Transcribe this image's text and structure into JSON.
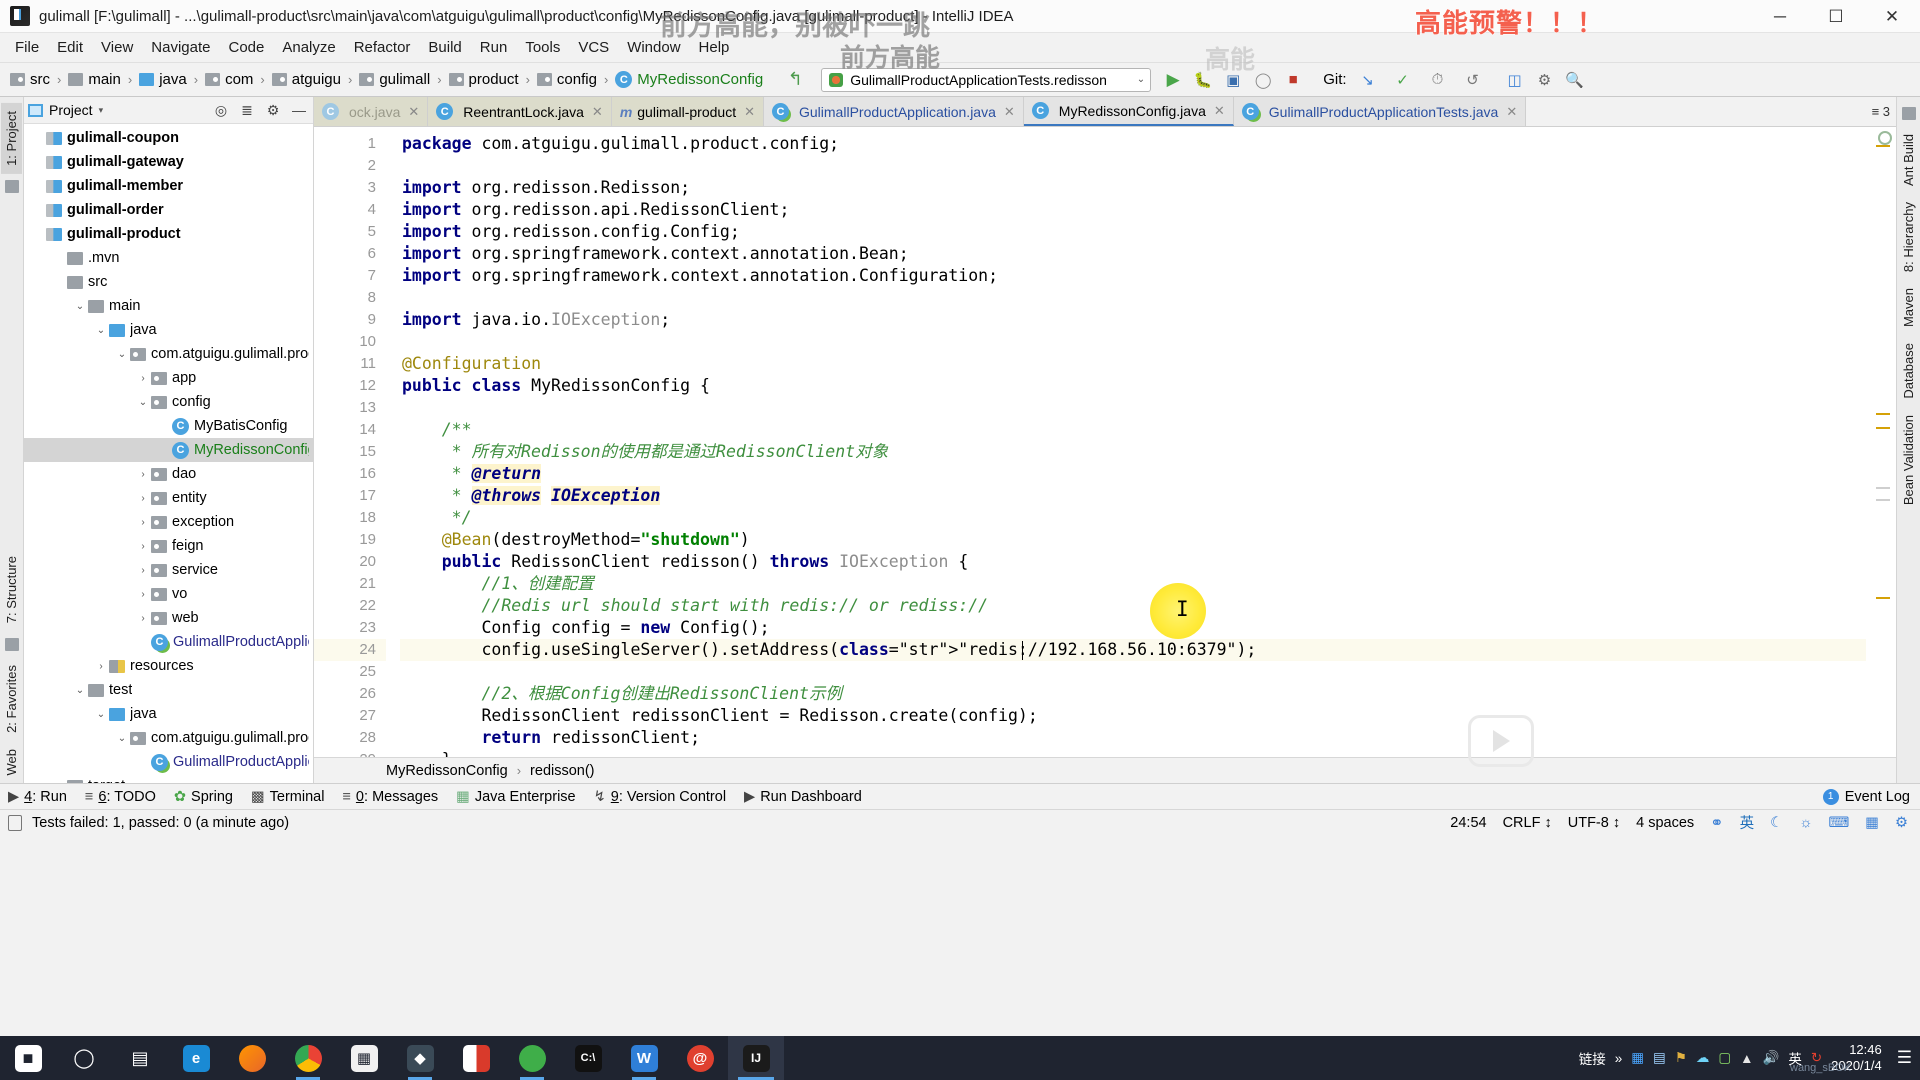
{
  "window": {
    "title": "gulimall [F:\\gulimall] - ...\\gulimall-product\\src\\main\\java\\com\\atguigu\\gulimall\\product\\config\\MyRedissonConfig.java [gulimall-product] - IntelliJ IDEA",
    "minimize": "─",
    "maximize": "☐",
    "close": "✕"
  },
  "menu": {
    "items": [
      "File",
      "Edit",
      "View",
      "Navigate",
      "Code",
      "Analyze",
      "Refactor",
      "Build",
      "Run",
      "Tools",
      "VCS",
      "Window",
      "Help"
    ]
  },
  "breadcrumb": {
    "items": [
      {
        "label": "src",
        "icon": "folder-source-icon"
      },
      {
        "label": "main",
        "icon": "folder-icon"
      },
      {
        "label": "java",
        "icon": "folder-java-icon"
      },
      {
        "label": "com",
        "icon": "package-icon"
      },
      {
        "label": "atguigu",
        "icon": "package-icon"
      },
      {
        "label": "gulimall",
        "icon": "package-icon"
      },
      {
        "label": "product",
        "icon": "package-icon"
      },
      {
        "label": "config",
        "icon": "package-icon"
      },
      {
        "label": "MyRedissonConfig",
        "icon": "java-class-icon"
      }
    ],
    "separator": "›"
  },
  "run_config": {
    "name": "GulimallProductApplicationTests.redisson",
    "dropdown_arrow": "⌄",
    "run_icon": "run-icon",
    "debug_icon": "debug-icon",
    "coverage_icon": "run-with-coverage-icon",
    "profile_icon": "profile-icon",
    "stop_icon": "stop-icon"
  },
  "git": {
    "label": "Git:",
    "update_icon": "update-project-icon",
    "commit_icon": "commit-icon",
    "history_icon": "history-icon",
    "rollback_icon": "rollback-icon"
  },
  "toolbar_right": {
    "search_icon": "search-everywhere-icon",
    "settings_icon": "settings-icon",
    "layout_icon": "layout-icon"
  },
  "project_panel": {
    "title": "Project",
    "caret": "▾",
    "locate_icon": "scroll-from-source-icon",
    "collapse_icon": "collapse-all-icon",
    "settings_icon": "gear-icon",
    "hide_icon": "hide-icon",
    "tree": [
      {
        "label": "gulimall-coupon",
        "indent": 0,
        "arrow": "",
        "icon": "module-icon",
        "bold": true,
        "selected": false,
        "color": ""
      },
      {
        "label": "gulimall-gateway",
        "indent": 0,
        "arrow": "",
        "icon": "module-icon",
        "bold": true,
        "selected": false,
        "color": ""
      },
      {
        "label": "gulimall-member",
        "indent": 0,
        "arrow": "",
        "icon": "module-icon",
        "bold": true,
        "selected": false,
        "color": ""
      },
      {
        "label": "gulimall-order",
        "indent": 0,
        "arrow": "",
        "icon": "module-icon",
        "bold": true,
        "selected": false,
        "color": ""
      },
      {
        "label": "gulimall-product",
        "indent": 0,
        "arrow": "",
        "icon": "module-icon",
        "bold": true,
        "selected": false,
        "color": ""
      },
      {
        "label": ".mvn",
        "indent": 1,
        "arrow": "",
        "icon": "folder-icon",
        "bold": false,
        "selected": false,
        "color": ""
      },
      {
        "label": "src",
        "indent": 1,
        "arrow": "",
        "icon": "folder-icon",
        "bold": false,
        "selected": false,
        "color": ""
      },
      {
        "label": "main",
        "indent": 2,
        "arrow": "⌄",
        "icon": "folder-icon",
        "bold": false,
        "selected": false,
        "color": ""
      },
      {
        "label": "java",
        "indent": 3,
        "arrow": "⌄",
        "icon": "folder-java-icon",
        "bold": false,
        "selected": false,
        "color": ""
      },
      {
        "label": "com.atguigu.gulimall.produc",
        "indent": 4,
        "arrow": "⌄",
        "icon": "package-icon",
        "bold": false,
        "selected": false,
        "color": ""
      },
      {
        "label": "app",
        "indent": 5,
        "arrow": "›",
        "icon": "package-icon",
        "bold": false,
        "selected": false,
        "color": ""
      },
      {
        "label": "config",
        "indent": 5,
        "arrow": "⌄",
        "icon": "package-icon",
        "bold": false,
        "selected": false,
        "color": ""
      },
      {
        "label": "MyBatisConfig",
        "indent": 6,
        "arrow": "",
        "icon": "java-class-icon",
        "bold": false,
        "selected": false,
        "color": ""
      },
      {
        "label": "MyRedissonConfig",
        "indent": 6,
        "arrow": "",
        "icon": "java-class-icon",
        "bold": false,
        "selected": true,
        "color": "green"
      },
      {
        "label": "dao",
        "indent": 5,
        "arrow": "›",
        "icon": "package-icon",
        "bold": false,
        "selected": false,
        "color": ""
      },
      {
        "label": "entity",
        "indent": 5,
        "arrow": "›",
        "icon": "package-icon",
        "bold": false,
        "selected": false,
        "color": ""
      },
      {
        "label": "exception",
        "indent": 5,
        "arrow": "›",
        "icon": "package-icon",
        "bold": false,
        "selected": false,
        "color": ""
      },
      {
        "label": "feign",
        "indent": 5,
        "arrow": "›",
        "icon": "package-icon",
        "bold": false,
        "selected": false,
        "color": ""
      },
      {
        "label": "service",
        "indent": 5,
        "arrow": "›",
        "icon": "package-icon",
        "bold": false,
        "selected": false,
        "color": ""
      },
      {
        "label": "vo",
        "indent": 5,
        "arrow": "›",
        "icon": "package-icon",
        "bold": false,
        "selected": false,
        "color": ""
      },
      {
        "label": "web",
        "indent": 5,
        "arrow": "›",
        "icon": "package-icon",
        "bold": false,
        "selected": false,
        "color": ""
      },
      {
        "label": "GulimallProductApplicatio",
        "indent": 5,
        "arrow": "",
        "icon": "java-runnable-class-icon",
        "bold": false,
        "selected": false,
        "color": "navy"
      },
      {
        "label": "resources",
        "indent": 3,
        "arrow": "›",
        "icon": "folder-resources-icon",
        "bold": false,
        "selected": false,
        "color": ""
      },
      {
        "label": "test",
        "indent": 2,
        "arrow": "⌄",
        "icon": "folder-icon",
        "bold": false,
        "selected": false,
        "color": ""
      },
      {
        "label": "java",
        "indent": 3,
        "arrow": "⌄",
        "icon": "folder-java-icon",
        "bold": false,
        "selected": false,
        "color": ""
      },
      {
        "label": "com.atguigu.gulimall.produc",
        "indent": 4,
        "arrow": "⌄",
        "icon": "package-icon",
        "bold": false,
        "selected": false,
        "color": ""
      },
      {
        "label": "GulimallProductApplicatio",
        "indent": 5,
        "arrow": "",
        "icon": "java-runnable-class-icon",
        "bold": false,
        "selected": false,
        "color": "navy"
      },
      {
        "label": "target",
        "indent": 1,
        "arrow": "",
        "icon": "folder-icon",
        "bold": false,
        "selected": false,
        "color": ""
      }
    ]
  },
  "left_strip": {
    "tabs": [
      "1: Project",
      "7: Structure",
      "2: Favorites",
      "Web"
    ]
  },
  "right_strip": {
    "tabs": [
      "Ant Build",
      "8: Hierarchy",
      "Maven",
      "Database",
      "Bean Validation"
    ]
  },
  "editor_tabs": [
    {
      "label": "ock.java",
      "icon": "java-class-icon",
      "state": "fade",
      "close": "✕"
    },
    {
      "label": "ReentrantLock.java",
      "icon": "java-class-icon",
      "state": "plainlbl",
      "close": "✕"
    },
    {
      "label": "gulimall-product",
      "icon": "maven-icon",
      "state": "plainlbl",
      "close": "✕"
    },
    {
      "label": "GulimallProductApplication.java",
      "icon": "java-runnable-class-icon",
      "state": "blue",
      "close": "✕"
    },
    {
      "label": "MyRedissonConfig.java",
      "icon": "java-class-icon",
      "state": "current",
      "close": "✕"
    },
    {
      "label": "GulimallProductApplicationTests.java",
      "icon": "java-runnable-class-icon",
      "state": "blue",
      "close": "✕"
    }
  ],
  "tabs_overflow": "≡ 3",
  "code": {
    "lines": [
      {
        "n": 1,
        "text": "package com.atguigu.gulimall.product.config;"
      },
      {
        "n": 2,
        "text": ""
      },
      {
        "n": 3,
        "text": "import org.redisson.Redisson;"
      },
      {
        "n": 4,
        "text": "import org.redisson.api.RedissonClient;"
      },
      {
        "n": 5,
        "text": "import org.redisson.config.Config;"
      },
      {
        "n": 6,
        "text": "import org.springframework.context.annotation.Bean;"
      },
      {
        "n": 7,
        "text": "import org.springframework.context.annotation.Configuration;"
      },
      {
        "n": 8,
        "text": ""
      },
      {
        "n": 9,
        "text": "import java.io.IOException;"
      },
      {
        "n": 10,
        "text": ""
      },
      {
        "n": 11,
        "text": "@Configuration"
      },
      {
        "n": 12,
        "text": "public class MyRedissonConfig {"
      },
      {
        "n": 13,
        "text": ""
      },
      {
        "n": 14,
        "text": "    /**"
      },
      {
        "n": 15,
        "text": "     * 所有对Redisson的使用都是通过RedissonClient对象"
      },
      {
        "n": 16,
        "text": "     * @return"
      },
      {
        "n": 17,
        "text": "     * @throws IOException"
      },
      {
        "n": 18,
        "text": "     */"
      },
      {
        "n": 19,
        "text": "    @Bean(destroyMethod=\"shutdown\")"
      },
      {
        "n": 20,
        "text": "    public RedissonClient redisson() throws IOException {"
      },
      {
        "n": 21,
        "text": "        //1、创建配置"
      },
      {
        "n": 22,
        "text": "        //Redis url should start with redis:// or rediss://"
      },
      {
        "n": 23,
        "text": "        Config config = new Config();"
      },
      {
        "n": 24,
        "text": "        config.useSingleServer().setAddress(\"redis://192.168.56.10:6379\");"
      },
      {
        "n": 25,
        "text": ""
      },
      {
        "n": 26,
        "text": "        //2、根据Config创建出RedissonClient示例"
      },
      {
        "n": 27,
        "text": "        RedissonClient redissonClient = Redisson.create(config);"
      },
      {
        "n": 28,
        "text": "        return redissonClient;"
      },
      {
        "n": 29,
        "text": "    }"
      },
      {
        "n": 30,
        "text": "}"
      }
    ],
    "current_line": 24,
    "redis_address": "redis://192.168.56.10:6379",
    "caret_column_hint": "after redis://"
  },
  "editor_breadcrumb": {
    "class": "MyRedissonConfig",
    "separator": "›",
    "method": "redisson()"
  },
  "bottom_tools": [
    {
      "num": "4",
      "label": "Run",
      "icon": "run-icon"
    },
    {
      "num": "6",
      "label": "TODO",
      "icon": "todo-icon"
    },
    {
      "num": "",
      "label": "Spring",
      "icon": "spring-icon"
    },
    {
      "num": "",
      "label": "Terminal",
      "icon": "terminal-icon"
    },
    {
      "num": "0",
      "label": "Messages",
      "icon": "messages-icon"
    },
    {
      "num": "",
      "label": "Java Enterprise",
      "icon": "java-enterprise-icon"
    },
    {
      "num": "9",
      "label": "Version Control",
      "icon": "version-control-icon"
    },
    {
      "num": "",
      "label": "Run Dashboard",
      "icon": "run-dashboard-icon"
    }
  ],
  "event_log": {
    "label": "Event Log",
    "badge": "1"
  },
  "status_bar": {
    "message": "Tests failed: 1, passed: 0 (a minute ago)",
    "caret_position": "24:54",
    "line_separator": "CRLF",
    "encoding": "UTF-8",
    "indent": "4 spaces",
    "ime": "英",
    "lock_icon": "unlocked-icon",
    "selectors_arrow": "↕"
  },
  "taskbar": {
    "start": "start-icon",
    "search": "search-icon",
    "taskview": "task-view-icon",
    "apps": [
      {
        "name": "edge-icon",
        "glyph": "e",
        "color": "#1a8ad4",
        "open": false
      },
      {
        "name": "firefox-icon",
        "glyph": "●",
        "color": "#e8662a",
        "open": false
      },
      {
        "name": "chrome-icon",
        "glyph": "●",
        "color": "#4285f4",
        "open": true
      },
      {
        "name": "microsoft-store-icon",
        "glyph": "⊞",
        "color": "#e8e8e8",
        "open": false
      },
      {
        "name": "xmind-icon",
        "glyph": "◆",
        "color": "#2f3e4d",
        "open": true
      },
      {
        "name": "foxit-pdf-icon",
        "glyph": "▰",
        "color": "#d93a2b",
        "open": false
      },
      {
        "name": "navicat-icon",
        "glyph": "●",
        "color": "#3fae49",
        "open": true
      },
      {
        "name": "cmd-icon",
        "glyph": "⎈",
        "color": "#1e1e1e",
        "open": false
      },
      {
        "name": "wps-icon",
        "glyph": "W",
        "color": "#2f7fd8",
        "open": true
      },
      {
        "name": "snail-icon",
        "glyph": "@",
        "color": "#e0402f",
        "open": false
      },
      {
        "name": "intellij-idea-icon",
        "glyph": "IJ",
        "color": "#1b1b1b",
        "open": true,
        "active": true
      }
    ],
    "tray_label": "链接",
    "tray_overflow": "»",
    "tray_icons": [
      "box-icon",
      "monitor-icon",
      "shield-icon",
      "cloud-icon",
      "screen-icon",
      "network-icon",
      "volume-icon"
    ],
    "ime": "英",
    "cloud_icon": "sync-icon",
    "clock_time": "12:46",
    "clock_date": "2020/1/4",
    "notification_icon": "notifications-icon"
  },
  "overlays": {
    "danmaku_top": "前方高能，别被吓一跳",
    "danmaku_second": "前方高能",
    "warn": "高能预警！！！",
    "light_right": "高能",
    "watermark": "wang_sBOK"
  },
  "colors": {
    "accent": "#3b78c0",
    "keyword": "#000080",
    "string": "#008000",
    "comment": "#3f8f3f",
    "annotation": "#9e880d",
    "selection": "#d4d4d4",
    "current_line": "#fcfaed",
    "warn_red": "#f4604e",
    "taskbar": "#1f2430"
  }
}
